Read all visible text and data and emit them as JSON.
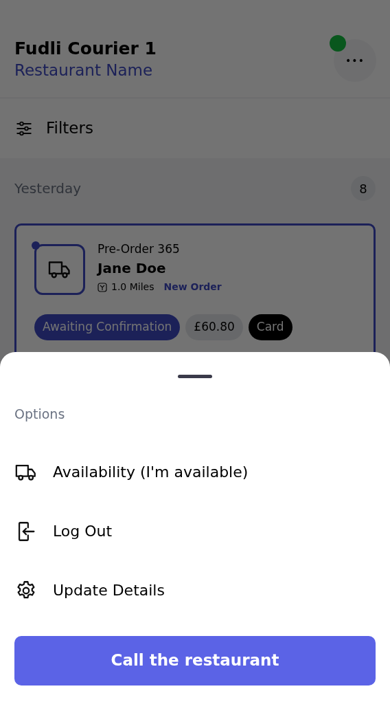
{
  "header": {
    "title": "Fudli Courier 1",
    "subtitle": "Restaurant Name",
    "online": true,
    "menu_label": "•••"
  },
  "filters": {
    "label": "Filters"
  },
  "section": {
    "title": "Yesterday",
    "count": "8"
  },
  "orders": [
    {
      "title": "Pre-Order 365",
      "customer": "Jane Doe",
      "distance": "1.0 Miles",
      "tag": "New Order",
      "unread": true,
      "selected": true,
      "status": "Awaiting Confirmation",
      "price": "£60.80",
      "payment": "Card"
    }
  ],
  "sheet": {
    "title": "Options",
    "items": [
      {
        "kind": "truck",
        "label": "Availability (I'm available)"
      },
      {
        "kind": "logout",
        "label": "Log Out"
      },
      {
        "kind": "gear",
        "label": "Update Details"
      }
    ],
    "button": "Call the restaurant"
  }
}
